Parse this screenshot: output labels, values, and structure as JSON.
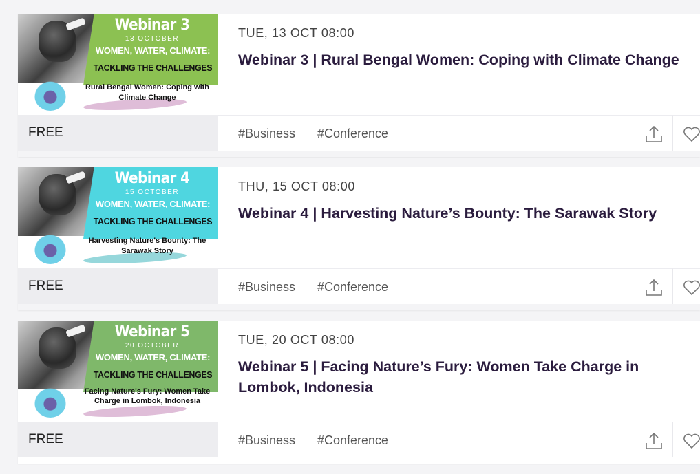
{
  "events": [
    {
      "thumb": {
        "heading": "Webinar 3",
        "date": "13 OCTOBER",
        "series_line1": "WOMEN, WATER, CLIMATE:",
        "series_line2": "TACKLING THE CHALLENGES",
        "topic": "Rural Bengal Women: Coping with Climate Change",
        "banner_color": "#8cc152",
        "brush_color": "#c586b8"
      },
      "date": "TUE, 13 OCT 08:00",
      "title": "Webinar 3 | Rural Bengal Women: Coping with Climate Change",
      "price": "FREE",
      "tags": [
        "#Business",
        "#Conference"
      ],
      "share_icon": "share-upload-icon",
      "like_icon": "heart-outline-icon"
    },
    {
      "thumb": {
        "heading": "Webinar 4",
        "date": "15 OCTOBER",
        "series_line1": "WOMEN, WATER, CLIMATE:",
        "series_line2": "TACKLING THE CHALLENGES",
        "topic": "Harvesting Nature's Bounty: The Sarawak Story",
        "banner_color": "#4fd6e0",
        "brush_color": "#3fb7bd"
      },
      "date": "THU, 15 OCT 08:00",
      "title": "Webinar 4 | Harvesting Nature’s Bounty: The Sarawak Story",
      "price": "FREE",
      "tags": [
        "#Business",
        "#Conference"
      ],
      "share_icon": "share-upload-icon",
      "like_icon": "heart-outline-icon"
    },
    {
      "thumb": {
        "heading": "Webinar 5",
        "date": "20 OCTOBER",
        "series_line1": "WOMEN, WATER, CLIMATE:",
        "series_line2": "TACKLING THE CHALLENGES",
        "topic": "Facing Nature's Fury: Women Take Charge in Lombok, Indonesia",
        "banner_color": "#7fb86a",
        "brush_color": "#c586b8"
      },
      "date": "TUE, 20 OCT 08:00",
      "title": "Webinar 5 | Facing Nature’s Fury: Women Take Charge in Lombok, Indonesia",
      "price": "FREE",
      "tags": [
        "#Business",
        "#Conference"
      ],
      "share_icon": "share-upload-icon",
      "like_icon": "heart-outline-icon"
    }
  ]
}
